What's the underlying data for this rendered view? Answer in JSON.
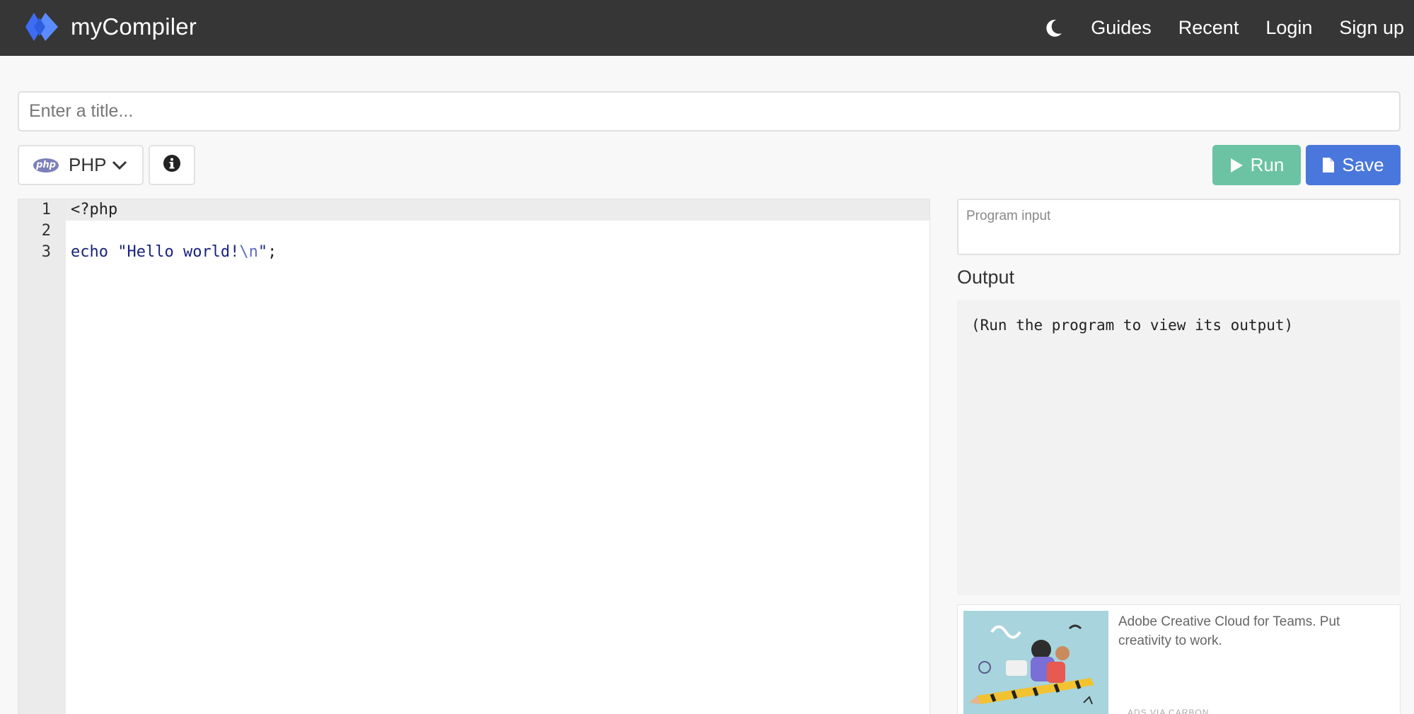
{
  "navbar": {
    "brand": "myCompiler",
    "links": [
      "Guides",
      "Recent",
      "Login",
      "Sign up"
    ],
    "theme_icon": "moon-icon"
  },
  "title_input": {
    "placeholder": "Enter a title...",
    "value": ""
  },
  "toolbar": {
    "language": "PHP",
    "language_icon": "php-icon",
    "info_icon": "info-icon",
    "run_label": "Run",
    "save_label": "Save",
    "run_color": "#6bc3a3",
    "save_color": "#4a77dc"
  },
  "editor": {
    "line_numbers": [
      "1",
      "2",
      "3"
    ],
    "lines": [
      "<?php",
      "",
      "echo \"Hello world!\\n\";"
    ],
    "code_tokens": {
      "open_tag": "<?php",
      "echo_kw": "echo",
      "str_open": "\"Hello world!",
      "str_escape": "\\n",
      "str_close": "\"",
      "semicolon": ";"
    }
  },
  "program_input": {
    "placeholder": "Program input",
    "value": ""
  },
  "output": {
    "heading": "Output",
    "text": "(Run the program to view its output)"
  },
  "ad": {
    "text": "Adobe Creative Cloud for Teams. Put creativity to work.",
    "via": "ADS VIA CARBON"
  }
}
